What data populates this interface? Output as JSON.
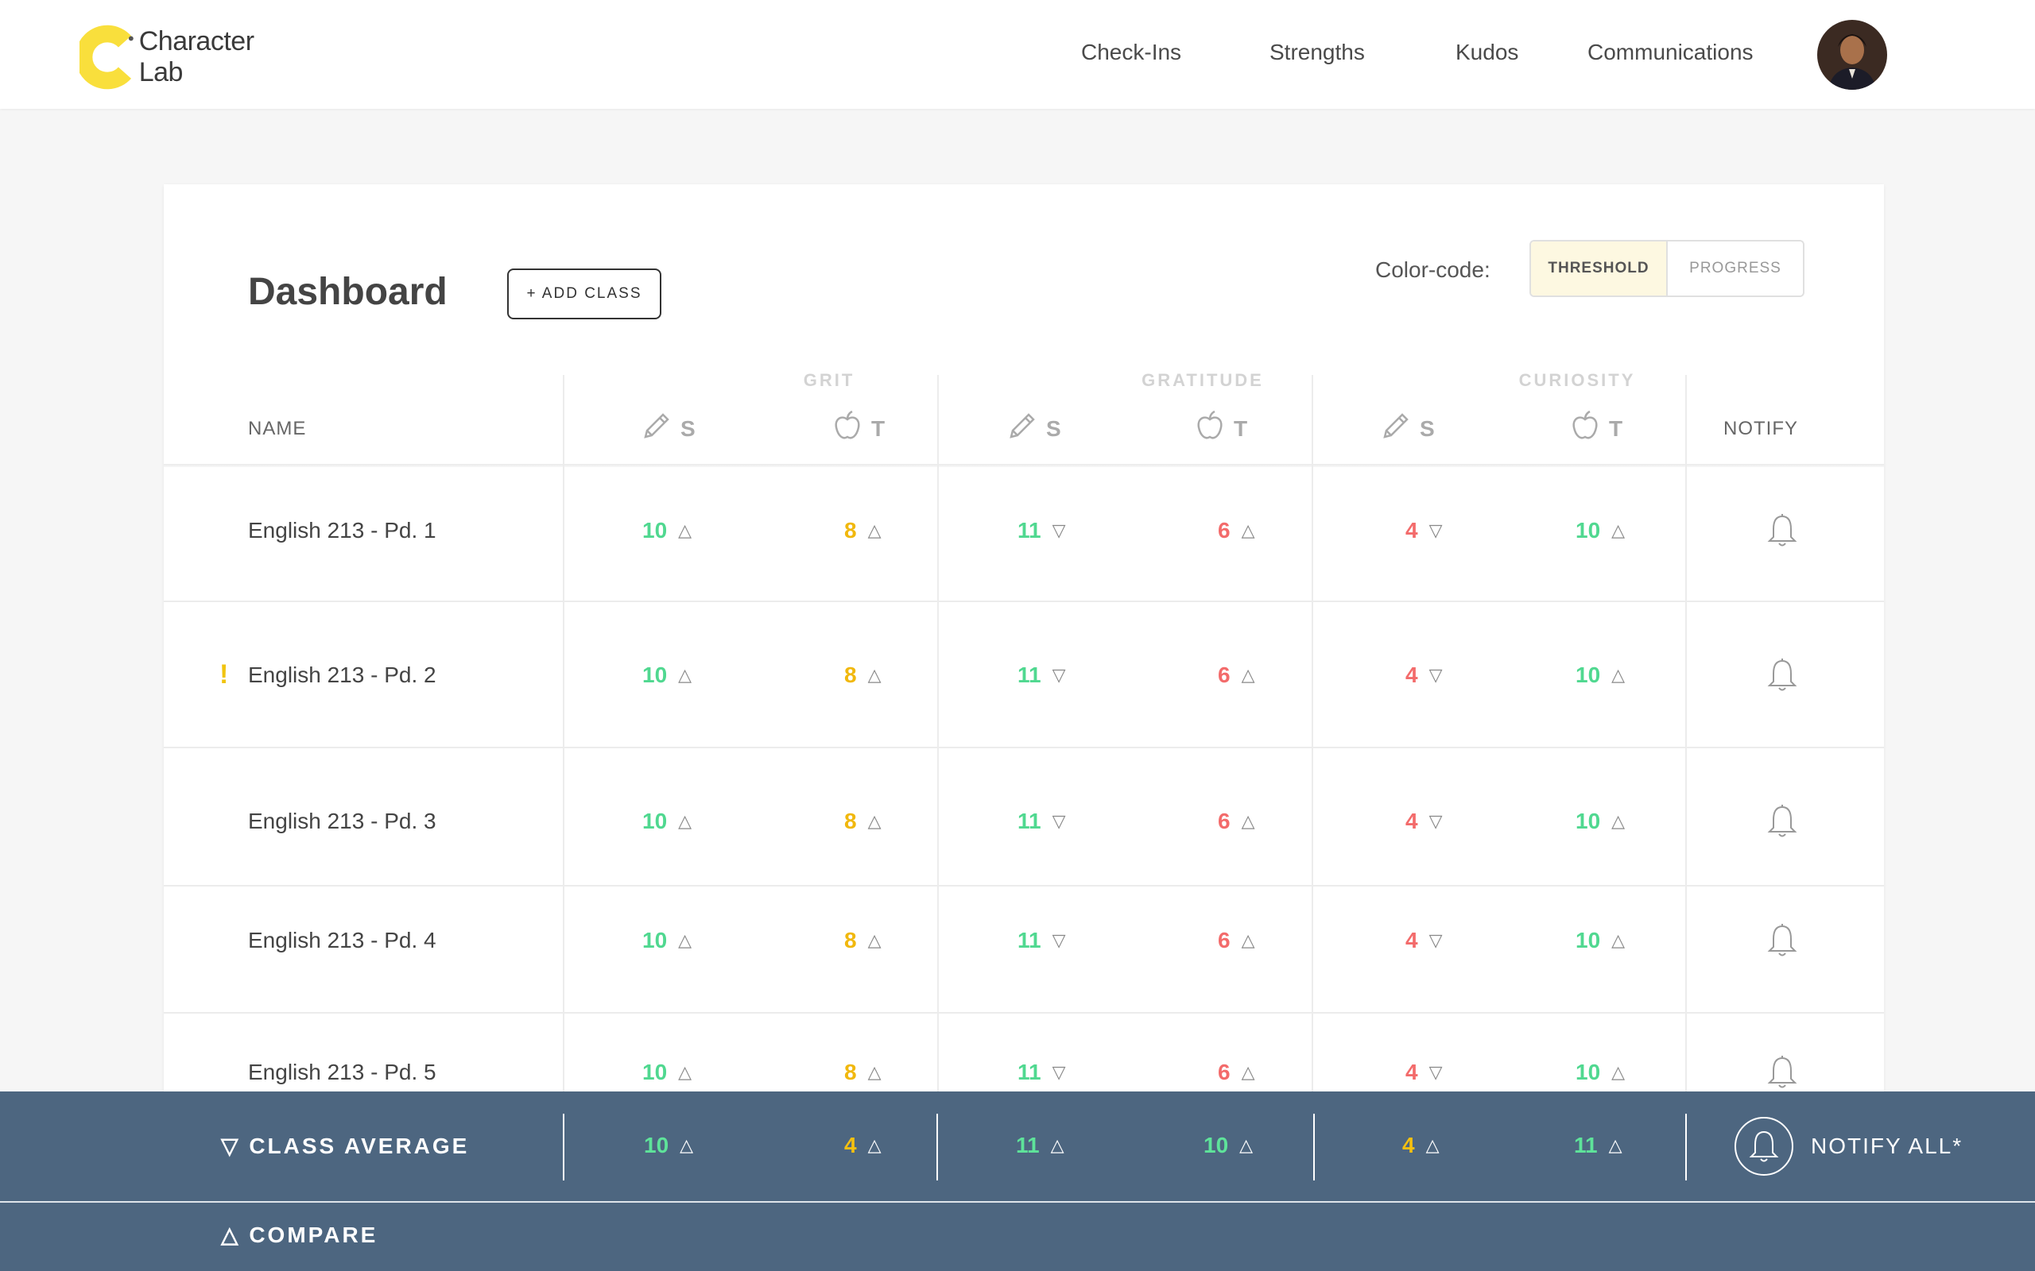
{
  "brand": {
    "name": "Character Lab",
    "accent": "#f9df3c"
  },
  "nav": {
    "items": [
      "Check-Ins",
      "Strengths",
      "Kudos",
      "Communications"
    ]
  },
  "dashboard": {
    "title": "Dashboard",
    "add_class_label": "+ ADD CLASS",
    "color_code_label": "Color-code:",
    "toggle": {
      "selected": "THRESHOLD",
      "options": [
        "THRESHOLD",
        "PROGRESS"
      ]
    }
  },
  "table": {
    "name_header": "NAME",
    "notify_header": "NOTIFY",
    "groups": [
      "GRIT",
      "GRATITUDE",
      "CURIOSITY"
    ],
    "sub_headers": [
      "S",
      "T"
    ],
    "sub_header_icons": [
      "pencil-icon",
      "apple-icon"
    ],
    "rows": [
      {
        "name": "English 213 - Pd. 1",
        "alert": "",
        "values": [
          "10",
          "8",
          "11",
          "6",
          "4",
          "10"
        ],
        "trends": [
          "up",
          "up",
          "down",
          "up",
          "down",
          "up"
        ]
      },
      {
        "name": "English 213 - Pd. 2",
        "alert": "!",
        "values": [
          "10",
          "8",
          "11",
          "6",
          "4",
          "10"
        ],
        "trends": [
          "up",
          "up",
          "down",
          "up",
          "down",
          "up"
        ]
      },
      {
        "name": "English 213 - Pd. 3",
        "alert": "",
        "values": [
          "10",
          "8",
          "11",
          "6",
          "4",
          "10"
        ],
        "trends": [
          "up",
          "up",
          "down",
          "up",
          "down",
          "up"
        ]
      },
      {
        "name": "English 213 - Pd. 4",
        "alert": "",
        "values": [
          "10",
          "8",
          "11",
          "6",
          "4",
          "10"
        ],
        "trends": [
          "up",
          "up",
          "down",
          "up",
          "down",
          "up"
        ]
      },
      {
        "name": "English 213 - Pd. 5",
        "alert": "",
        "values": [
          "10",
          "8",
          "11",
          "6",
          "4",
          "10"
        ],
        "trends": [
          "up",
          "up",
          "down",
          "up",
          "down",
          "up"
        ]
      }
    ],
    "value_colors": [
      "#50d890",
      "#f1b80d",
      "#50d890",
      "#f36b6b",
      "#f36b6b",
      "#50d890"
    ]
  },
  "footer": {
    "class_average_label": "▽ CLASS AVERAGE",
    "class_average_values": [
      "10",
      "4",
      "11",
      "10",
      "4",
      "11"
    ],
    "class_average_colors": [
      "#5ee39a",
      "#f5c010",
      "#5ee39a",
      "#5ee39a",
      "#f5c010",
      "#5ee39a"
    ],
    "class_average_trends": [
      "up",
      "up",
      "up",
      "up",
      "up",
      "up"
    ],
    "notify_all_label": "NOTIFY ALL*",
    "compare_label": "△ COMPARE"
  }
}
